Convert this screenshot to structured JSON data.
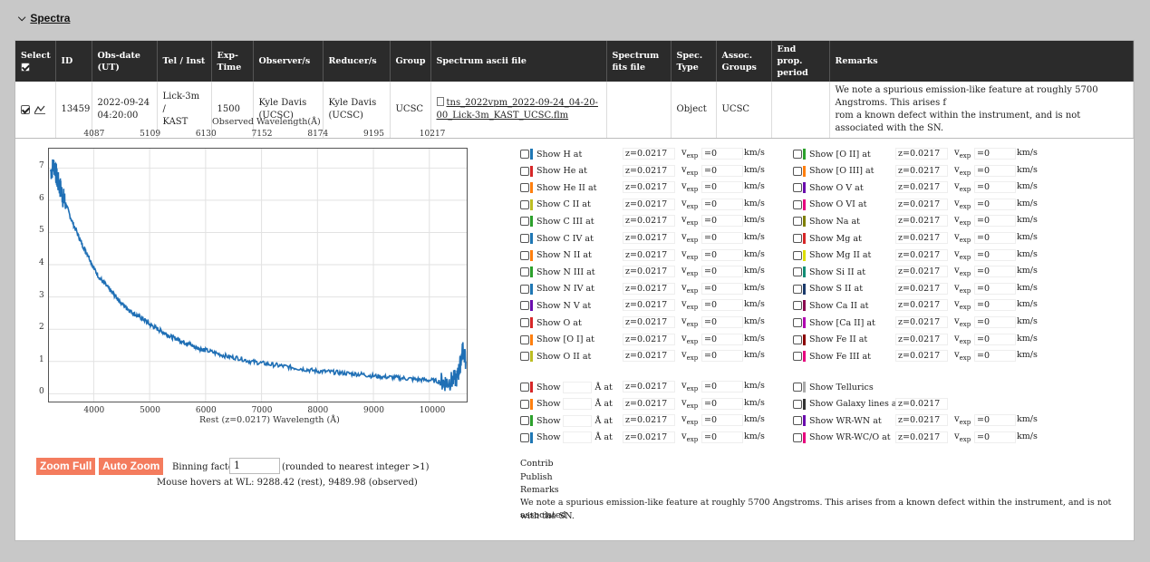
{
  "section": {
    "title": "Spectra"
  },
  "table": {
    "headers": [
      "Select",
      "ID",
      "Obs-date (UT)",
      "Tel / Inst",
      "Exp-Time",
      "Observer/s",
      "Reducer/s",
      "Group",
      "Spectrum ascii file",
      "Spectrum fits file",
      "Spec. Type",
      "Assoc. Groups",
      "End prop. period",
      "Remarks"
    ],
    "row": {
      "id": "13459",
      "obs_date_1": "2022-09-24",
      "obs_date_2": "04:20:00",
      "tel_1": "Lick-3m /",
      "tel_2": "KAST",
      "exp_time": "1500",
      "observer_1": "Kyle Davis",
      "observer_2": "(UCSC)",
      "reducer_1": "Kyle Davis",
      "reducer_2": "(UCSC)",
      "group": "UCSC",
      "ascii_file_1": "tns_2022vpm_2022-09-24_04-20-",
      "ascii_file_2": "00_Lick-3m_KAST_UCSC.flm",
      "fits_file": "",
      "spec_type": "Object",
      "assoc_groups": "UCSC",
      "end_prop": "",
      "remarks_1": "We note a spurious emission-like feature at roughly 5700 Angstroms. This arises f",
      "remarks_2": "rom a known defect within the instrument, and is not associated with the SN."
    }
  },
  "chart_data": {
    "type": "line",
    "title": "",
    "top_axis_label": "Observed Wavelength(Å)",
    "xlabel": "Rest (z=0.0217) Wavelength (Å)",
    "ylabel": "",
    "top_ticks": [
      "4087",
      "5109",
      "6130",
      "7152",
      "8174",
      "9195",
      "10217"
    ],
    "x_ticks": [
      "4000",
      "5000",
      "6000",
      "7000",
      "8000",
      "9000",
      "10000"
    ],
    "y_ticks": [
      "0",
      "1",
      "2",
      "3",
      "4",
      "5",
      "6",
      "7"
    ],
    "xlim": [
      3200,
      10700
    ],
    "ylim": [
      -0.3,
      7.6
    ],
    "grid": true,
    "series": [
      {
        "color": "#1f6fb5",
        "x": [
          3230,
          3300,
          3350,
          3400,
          3450,
          3500,
          3600,
          3700,
          3800,
          3900,
          4000,
          4100,
          4200,
          4300,
          4400,
          4500,
          4600,
          4700,
          4800,
          4900,
          5000,
          5100,
          5200,
          5300,
          5400,
          5500,
          5600,
          5700,
          5800,
          5900,
          6000,
          6200,
          6400,
          6600,
          6800,
          7000,
          7200,
          7400,
          7600,
          7800,
          8000,
          8200,
          8400,
          8600,
          8800,
          9000,
          9200,
          9400,
          9600,
          9800,
          10000,
          10200,
          10300,
          10400,
          10500,
          10550,
          10600,
          10650
        ],
        "y": [
          6.9,
          7.1,
          6.6,
          6.4,
          6.1,
          5.9,
          5.4,
          5.0,
          4.6,
          4.3,
          3.9,
          3.6,
          3.4,
          3.2,
          3.0,
          2.8,
          2.65,
          2.5,
          2.4,
          2.3,
          2.15,
          2.05,
          1.95,
          1.85,
          1.75,
          1.7,
          1.6,
          1.55,
          1.45,
          1.4,
          1.35,
          1.25,
          1.15,
          1.1,
          1.0,
          0.95,
          0.9,
          0.85,
          0.8,
          0.75,
          0.7,
          0.68,
          0.65,
          0.62,
          0.6,
          0.55,
          0.52,
          0.5,
          0.47,
          0.44,
          0.42,
          0.38,
          0.35,
          0.4,
          0.5,
          0.9,
          1.4,
          1.0
        ]
      }
    ]
  },
  "controls": {
    "zoom_full": "Zoom Full",
    "auto_zoom": "Auto Zoom",
    "binning_label": "Binning factor:",
    "binning_value": "1",
    "binning_note": "(rounded to nearest integer >1)",
    "hover": "Mouse hovers at WL: 9288.42 (rest), 9489.98 (observed)"
  },
  "lines_left": [
    {
      "label": "Show H at",
      "color": "#1f77b4"
    },
    {
      "label": "Show He at",
      "color": "#d62728"
    },
    {
      "label": "Show He II at",
      "color": "#ff7f0e"
    },
    {
      "label": "Show C II at",
      "color": "#bcbd22"
    },
    {
      "label": "Show C III at",
      "color": "#2ca02c"
    },
    {
      "label": "Show C IV at",
      "color": "#1f77b4"
    },
    {
      "label": "Show N II at",
      "color": "#ff7f0e"
    },
    {
      "label": "Show N III at",
      "color": "#2ca02c"
    },
    {
      "label": "Show N IV at",
      "color": "#1f77b4"
    },
    {
      "label": "Show N V at",
      "color": "#6a0dad"
    },
    {
      "label": "Show O at",
      "color": "#d62728"
    },
    {
      "label": "Show [O I] at",
      "color": "#ff7f0e"
    },
    {
      "label": "Show O II at",
      "color": "#bcbd22"
    }
  ],
  "lines_right": [
    {
      "label": "Show [O II] at",
      "color": "#2ca02c"
    },
    {
      "label": "Show [O III] at",
      "color": "#ff7f0e"
    },
    {
      "label": "Show O V at",
      "color": "#6a0dad"
    },
    {
      "label": "Show O VI at",
      "color": "#e6007e"
    },
    {
      "label": "Show Na at",
      "color": "#808000"
    },
    {
      "label": "Show Mg at",
      "color": "#d62728"
    },
    {
      "label": "Show Mg II at",
      "color": "#dddd00"
    },
    {
      "label": "Show Si II at",
      "color": "#138d75"
    },
    {
      "label": "Show S II at",
      "color": "#1b3a6b"
    },
    {
      "label": "Show Ca II at",
      "color": "#8b0a50"
    },
    {
      "label": "Show [Ca II] at",
      "color": "#b000b0"
    },
    {
      "label": "Show Fe II at",
      "color": "#8b0000"
    },
    {
      "label": "Show Fe III at",
      "color": "#e6007e"
    }
  ],
  "z_value": "0.0217",
  "z_prefix": "z=",
  "v_prefix": "v",
  "v_sub": "exp",
  "v_eq": "=",
  "v_value": "0",
  "kms": "km/s",
  "custom_lines": [
    {
      "color": "#d62728"
    },
    {
      "color": "#ff7f0e"
    },
    {
      "color": "#2ca02c"
    },
    {
      "color": "#1f77b4"
    }
  ],
  "custom_show": "Show",
  "custom_at": "Å at",
  "extra_lines": [
    {
      "label": "Show Tellurics",
      "color": "#aaaaaa"
    },
    {
      "label": "Show Galaxy lines at",
      "color": "#333333"
    },
    {
      "label": "Show WR-WN at",
      "color": "#6a0dad"
    },
    {
      "label": "Show WR-WC/O at",
      "color": "#e6007e"
    }
  ],
  "meta": {
    "contrib": "Contrib",
    "publish": "Publish",
    "remarks_label": "Remarks",
    "remarks_1": "We note a spurious emission-like feature at roughly 5700 Angstroms. This arises from a known defect within the instrument, and is not associated",
    "remarks_2": "with the SN."
  }
}
